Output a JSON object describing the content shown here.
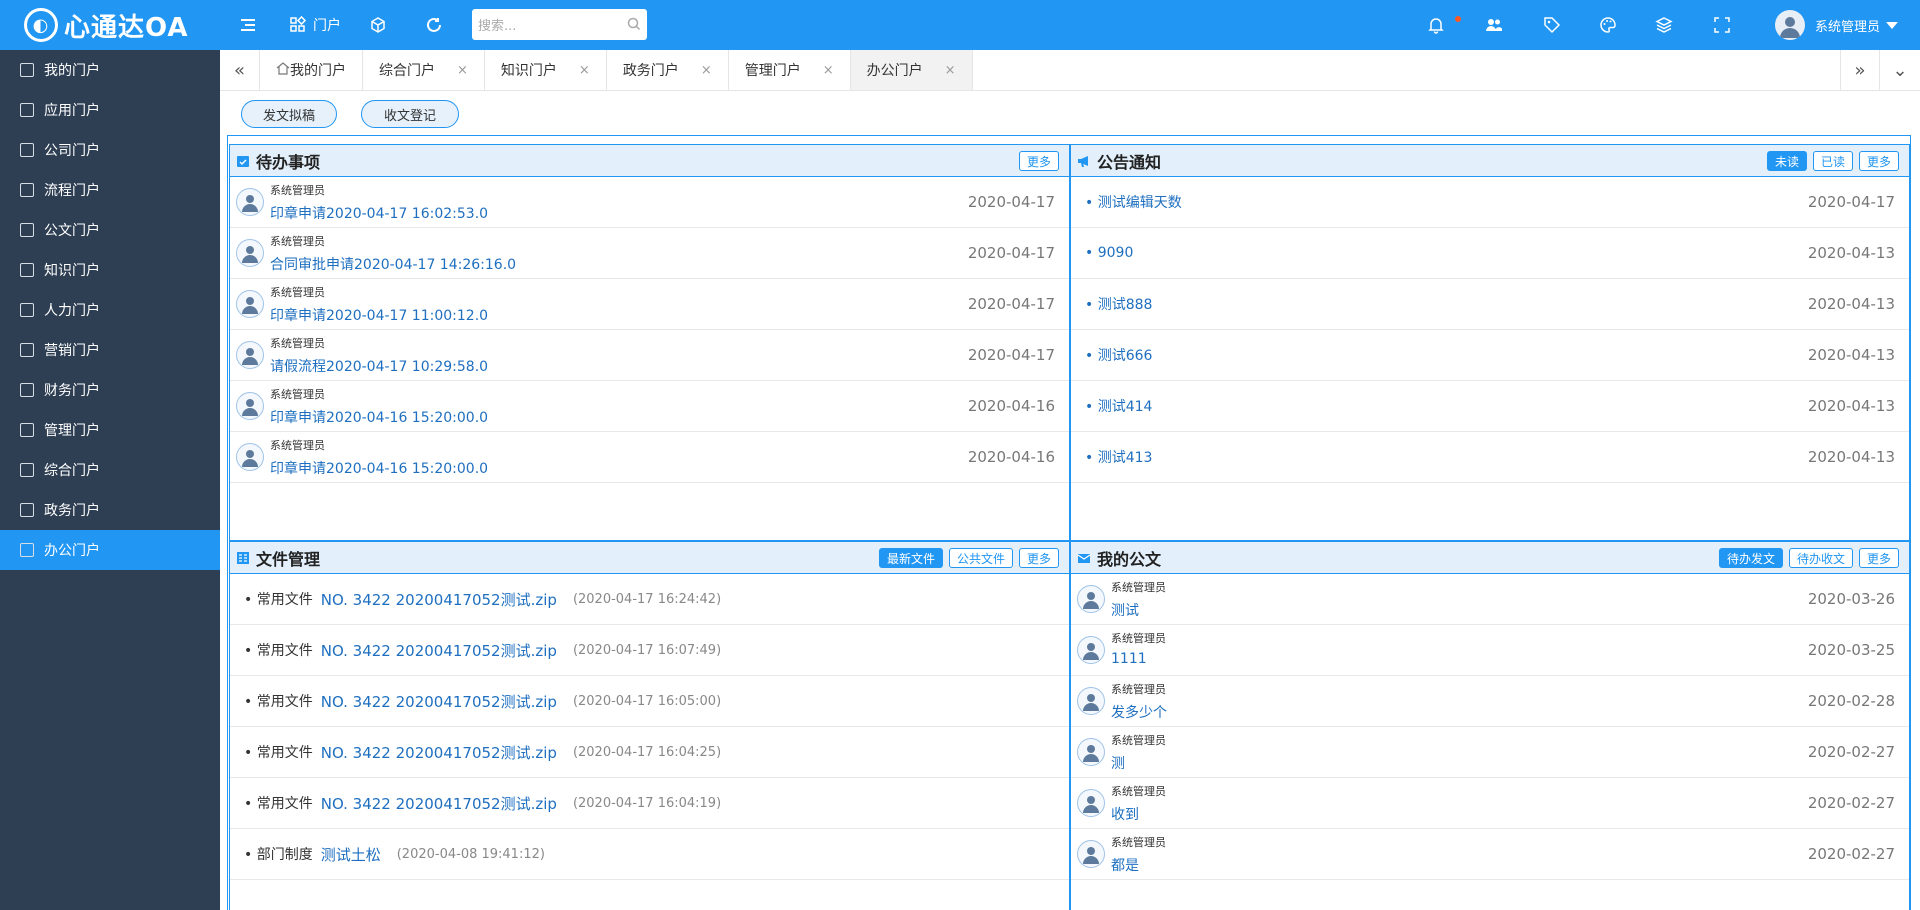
{
  "app": {
    "logo_text": "心通达OA",
    "logo_mark": "◐"
  },
  "topbar": {
    "portal_label": "门户",
    "search_placeholder": "搜索...",
    "user_name": "系统管理员"
  },
  "sidebar": {
    "items": [
      {
        "label": "我的门户",
        "icon": "user-icon"
      },
      {
        "label": "应用门户",
        "icon": "apps-icon"
      },
      {
        "label": "公司门户",
        "icon": "company-icon"
      },
      {
        "label": "流程门户",
        "icon": "flow-icon"
      },
      {
        "label": "公文门户",
        "icon": "document-icon"
      },
      {
        "label": "知识门户",
        "icon": "book-icon"
      },
      {
        "label": "人力门户",
        "icon": "people-icon"
      },
      {
        "label": "营销门户",
        "icon": "calendar-icon"
      },
      {
        "label": "财务门户",
        "icon": "yen-icon"
      },
      {
        "label": "管理门户",
        "icon": "grid-icon"
      },
      {
        "label": "综合门户",
        "icon": "list-icon"
      },
      {
        "label": "政务门户",
        "icon": "list-icon"
      },
      {
        "label": "办公门户",
        "icon": "window-icon"
      }
    ],
    "active_index": 12
  },
  "tabs": [
    {
      "label": "我的门户",
      "closable": false,
      "home": true
    },
    {
      "label": "综合门户",
      "closable": true
    },
    {
      "label": "知识门户",
      "closable": true
    },
    {
      "label": "政务门户",
      "closable": true
    },
    {
      "label": "管理门户",
      "closable": true
    },
    {
      "label": "办公门户",
      "closable": true,
      "active": true
    }
  ],
  "tab_close_glyph": "×",
  "tab_nav": {
    "prev": "«",
    "next": "»",
    "menu": "⌄"
  },
  "actions": {
    "draft": "发文拟稿",
    "receive": "收文登记"
  },
  "todo": {
    "title": "待办事项",
    "more": "更多",
    "items": [
      {
        "who": "系统管理员",
        "text": "印章申请2020-04-17 16:02:53.0",
        "date": "2020-04-17"
      },
      {
        "who": "系统管理员",
        "text": "合同审批申请2020-04-17 14:26:16.0",
        "date": "2020-04-17"
      },
      {
        "who": "系统管理员",
        "text": "印章申请2020-04-17 11:00:12.0",
        "date": "2020-04-17"
      },
      {
        "who": "系统管理员",
        "text": "请假流程2020-04-17 10:29:58.0",
        "date": "2020-04-17"
      },
      {
        "who": "系统管理员",
        "text": "印章申请2020-04-16 15:20:00.0",
        "date": "2020-04-16"
      },
      {
        "who": "系统管理员",
        "text": "印章申请2020-04-16 15:20:00.0",
        "date": "2020-04-16"
      }
    ]
  },
  "notice": {
    "title": "公告通知",
    "btn_unread": "未读",
    "btn_read": "已读",
    "more": "更多",
    "items": [
      {
        "text": "测试编辑天数",
        "date": "2020-04-17"
      },
      {
        "text": "9090",
        "date": "2020-04-13"
      },
      {
        "text": "测试888",
        "date": "2020-04-13"
      },
      {
        "text": "测试666",
        "date": "2020-04-13"
      },
      {
        "text": "测试414",
        "date": "2020-04-13"
      },
      {
        "text": "测试413",
        "date": "2020-04-13"
      }
    ]
  },
  "files": {
    "title": "文件管理",
    "btn_latest": "最新文件",
    "btn_public": "公共文件",
    "more": "更多",
    "items": [
      {
        "category": "常用文件",
        "name": "NO. 3422 20200417052测试.zip",
        "time": "(2020-04-17 16:24:42)"
      },
      {
        "category": "常用文件",
        "name": "NO. 3422 20200417052测试.zip",
        "time": "(2020-04-17 16:07:49)"
      },
      {
        "category": "常用文件",
        "name": "NO. 3422 20200417052测试.zip",
        "time": "(2020-04-17 16:05:00)"
      },
      {
        "category": "常用文件",
        "name": "NO. 3422 20200417052测试.zip",
        "time": "(2020-04-17 16:04:25)"
      },
      {
        "category": "常用文件",
        "name": "NO. 3422 20200417052测试.zip",
        "time": "(2020-04-17 16:04:19)"
      },
      {
        "category": "部门制度",
        "name": "测试土松",
        "time": "(2020-04-08 19:41:12)"
      }
    ]
  },
  "mydocs": {
    "title": "我的公文",
    "btn_send": "待办发文",
    "btn_recv": "待办收文",
    "more": "更多",
    "items": [
      {
        "who": "系统管理员",
        "text": "测试",
        "date": "2020-03-26"
      },
      {
        "who": "系统管理员",
        "text": "1111",
        "date": "2020-03-25"
      },
      {
        "who": "系统管理员",
        "text": "发多少个",
        "date": "2020-02-28"
      },
      {
        "who": "系统管理员",
        "text": "测",
        "date": "2020-02-27"
      },
      {
        "who": "系统管理员",
        "text": "收到",
        "date": "2020-02-27"
      },
      {
        "who": "系统管理员",
        "text": "都是",
        "date": "2020-02-27"
      }
    ]
  },
  "colors": {
    "primary": "#2196f3",
    "sidebar": "#2e3e53",
    "link": "#1e6fc0"
  }
}
